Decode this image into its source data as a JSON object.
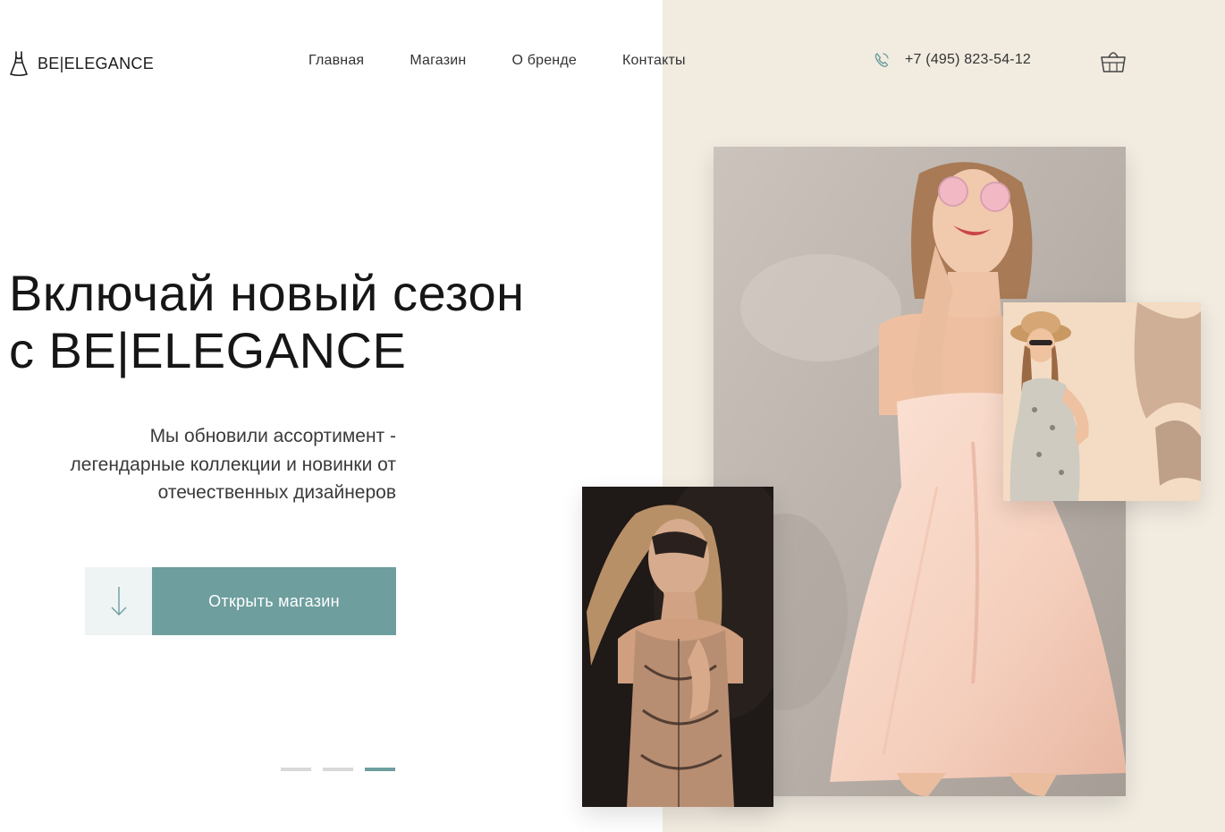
{
  "header": {
    "logo_text": "BE|ELEGANCE",
    "logo_icon": "dress-icon",
    "nav": [
      {
        "label": "Главная"
      },
      {
        "label": "Магазин"
      },
      {
        "label": "О бренде"
      },
      {
        "label": "Контакты"
      }
    ],
    "phone": "+7 (495) 823-54-12",
    "phone_icon": "phone-icon",
    "cart_icon": "shopping-basket-icon"
  },
  "hero": {
    "title_line1": "Включай новый сезон",
    "title_line2": "с BE|ELEGANCE",
    "subtitle_line1": "Мы обновили ассортимент -",
    "subtitle_line2": "легендарные коллекции и новинки от",
    "subtitle_line3": "отечественных дизайнеров",
    "cta_label": "Открыть магазин",
    "cta_icon": "arrow-down-icon"
  },
  "slider": {
    "count": 3,
    "active": 3
  },
  "colors": {
    "accent": "#6e9e9e",
    "accent_light": "#eef3f3",
    "beige": "#f1ebe0",
    "text": "#1c1c1c",
    "dot_inactive": "#d9d9d9"
  }
}
